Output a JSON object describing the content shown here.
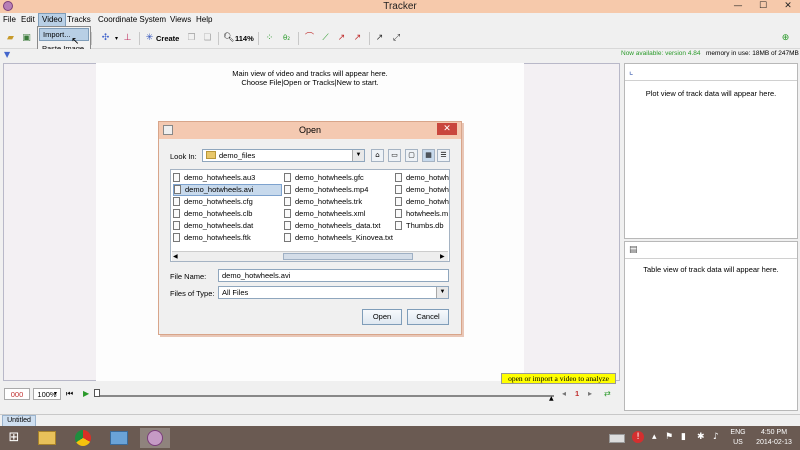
{
  "window": {
    "title": "Tracker",
    "minimize": "—",
    "maximize": "☐",
    "close": "✕"
  },
  "menubar": {
    "items": [
      "File",
      "Edit",
      "Video",
      "Tracks",
      "Coordinate System",
      "Views",
      "Help"
    ],
    "active": "Video"
  },
  "video_menu": {
    "items": [
      "Import...",
      "Paste Image"
    ],
    "hovered": "Import..."
  },
  "toolbar": {
    "create_label": "Create",
    "zoom_label": "114%"
  },
  "status": {
    "new_version": "Now available: version 4.84",
    "memory": "memory in use: 18MB of 247MB"
  },
  "main_view": {
    "line1": "Main view of video and tracks will appear here.",
    "line2": "Choose File|Open or Tracks|New to start."
  },
  "plot_panel": {
    "text": "Plot view of track data will appear here."
  },
  "table_panel": {
    "text": "Table view of track data will appear here."
  },
  "open_dialog": {
    "title": "Open",
    "look_in_label": "Look In:",
    "look_in_value": "demo_files",
    "files": [
      [
        "demo_hotwheels.au3",
        "demo_hotwheels.gfc",
        "demo_hotwh"
      ],
      [
        "demo_hotwheels.avi",
        "demo_hotwheels.mp4",
        "demo_hotwh"
      ],
      [
        "demo_hotwheels.cfg",
        "demo_hotwheels.trk",
        "demo_hotwh"
      ],
      [
        "demo_hotwheels.clb",
        "demo_hotwheels.xml",
        "hotwheels.m"
      ],
      [
        "demo_hotwheels.dat",
        "demo_hotwheels_data.txt",
        "Thumbs.db"
      ],
      [
        "demo_hotwheels.ftk",
        "demo_hotwheels_Kinovea.txt",
        ""
      ]
    ],
    "selected_file": "demo_hotwheels.avi",
    "file_name_label": "File Name:",
    "file_name_value": "demo_hotwheels.avi",
    "files_of_type_label": "Files of Type:",
    "files_of_type_value": "All Files",
    "open_button": "Open",
    "cancel_button": "Cancel"
  },
  "player": {
    "frame_number": "000",
    "rate": "100%",
    "step_value": "1"
  },
  "hint": "open or import a video to analyze",
  "tabs": {
    "untitled": "Untitled"
  },
  "system_tray": {
    "lang_top": "ENG",
    "lang_bottom": "US",
    "time": "4:50 PM",
    "date": "2014-02-13"
  },
  "colors": {
    "titlebar": "#f6c9ab",
    "accent": "#b8cfe5",
    "new_version_text": "#2a9a2a",
    "hint_bg": "#ffff00",
    "taskbar": "#6a5a52"
  }
}
